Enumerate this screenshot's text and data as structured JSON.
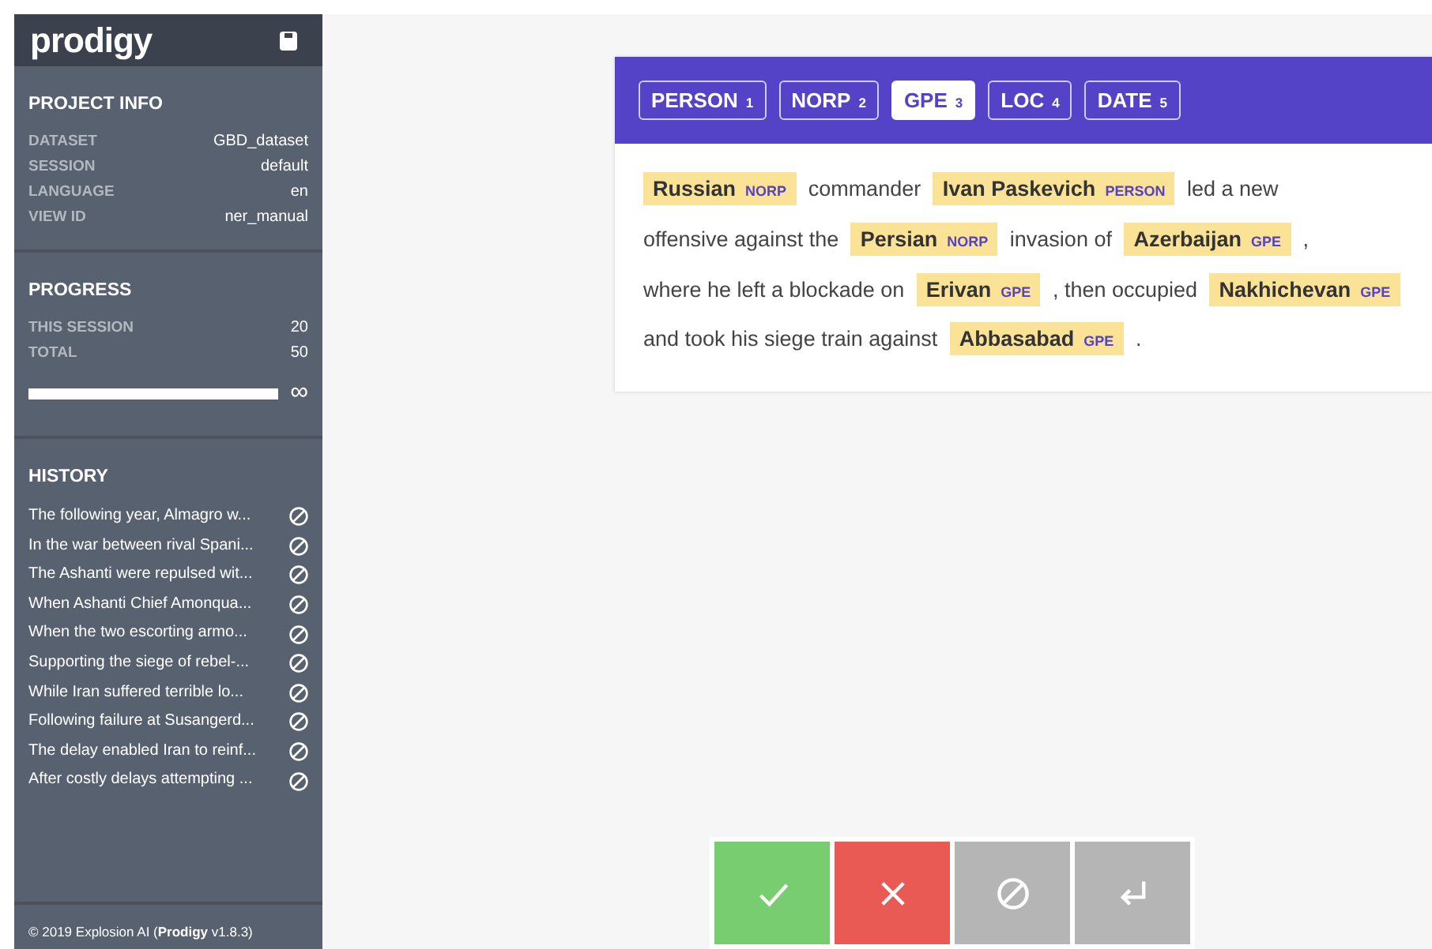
{
  "sidebar": {
    "logo": "prodigy",
    "project_info": {
      "title": "PROJECT INFO",
      "rows": [
        {
          "label": "DATASET",
          "value": "GBD_dataset"
        },
        {
          "label": "SESSION",
          "value": "default"
        },
        {
          "label": "LANGUAGE",
          "value": "en"
        },
        {
          "label": "VIEW ID",
          "value": "ner_manual"
        }
      ]
    },
    "progress": {
      "title": "PROGRESS",
      "rows": [
        {
          "label": "THIS SESSION",
          "value": "20"
        },
        {
          "label": "TOTAL",
          "value": "50"
        }
      ],
      "level": 1,
      "total_symbol": "∞"
    },
    "history": {
      "title": "HISTORY",
      "items": [
        {
          "text": "The following year, Almagro w..."
        },
        {
          "text": "In the war between rival Spani..."
        },
        {
          "text": "The Ashanti were repulsed wit..."
        },
        {
          "text": "When Ashanti Chief Amonqua..."
        },
        {
          "text": "When the two escorting armo..."
        },
        {
          "text": "Supporting the siege of rebel-..."
        },
        {
          "text": "While Iran suffered terrible lo..."
        },
        {
          "text": "Following failure at Susangerd..."
        },
        {
          "text": "The delay enabled Iran to reinf..."
        },
        {
          "text": "After costly delays attempting ..."
        }
      ]
    },
    "footer": "© 2019 Explosion AI   (**Prodigy** v1.8.3)"
  },
  "labels": [
    {
      "label": "PERSON",
      "key": "1",
      "selected": false
    },
    {
      "label": "NORP",
      "key": "2",
      "selected": false
    },
    {
      "label": "GPE",
      "key": "3",
      "selected": true
    },
    {
      "label": "LOC",
      "key": "4",
      "selected": false
    },
    {
      "label": "DATE",
      "key": "5",
      "selected": false
    }
  ],
  "tokens": [
    {
      "kind": "entity",
      "text": "Russian",
      "label": "NORP"
    },
    {
      "kind": "text",
      "text": "commander"
    },
    {
      "kind": "entity",
      "text": "Ivan Paskevich",
      "label": "PERSON"
    },
    {
      "kind": "text",
      "text": "led a new"
    },
    {
      "kind": "text",
      "text": "offensive against the"
    },
    {
      "kind": "entity",
      "text": "Persian",
      "label": "NORP"
    },
    {
      "kind": "text",
      "text": "invasion of"
    },
    {
      "kind": "entity",
      "text": "Azerbaijan",
      "label": "GPE"
    },
    {
      "kind": "text",
      "text": ","
    },
    {
      "kind": "text",
      "text": "where he left a blockade on"
    },
    {
      "kind": "entity",
      "text": "Erivan",
      "label": "GPE"
    },
    {
      "kind": "text",
      "text": ", then occupied"
    },
    {
      "kind": "entity",
      "text": "Nakhichevan",
      "label": "GPE"
    },
    {
      "kind": "text",
      "text": "and took his siege train against"
    },
    {
      "kind": "entity",
      "text": "Abbasabad",
      "label": "GPE"
    },
    {
      "kind": "text",
      "text": "."
    }
  ],
  "actions": [
    {
      "kind": "accept"
    },
    {
      "kind": "reject"
    },
    {
      "kind": "ignore"
    },
    {
      "kind": "undo"
    }
  ]
}
